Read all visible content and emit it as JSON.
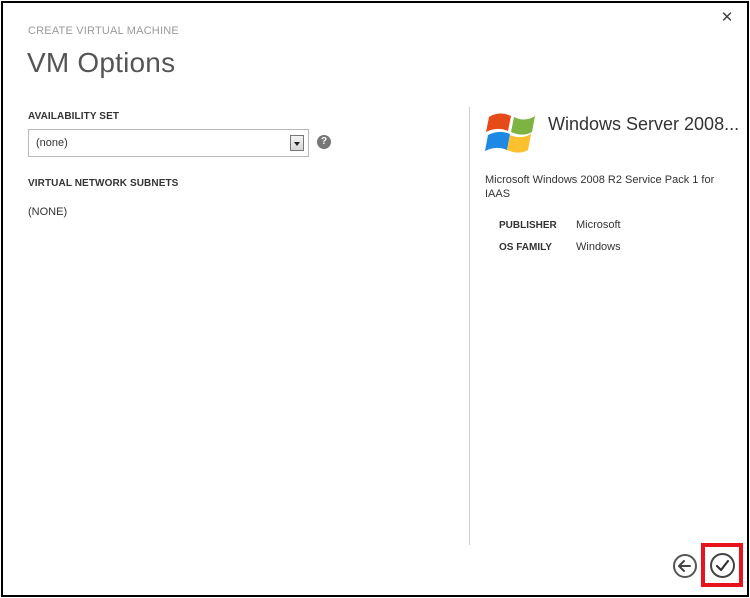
{
  "dialog": {
    "eyebrow": "CREATE VIRTUAL MACHINE",
    "title": "VM Options",
    "close_icon": "close-icon"
  },
  "form": {
    "availability_set": {
      "label": "AVAILABILITY SET",
      "value": "(none)",
      "help_glyph": "?"
    },
    "virtual_network_subnets": {
      "label": "VIRTUAL NETWORK SUBNETS",
      "value": "(NONE)"
    }
  },
  "image_info": {
    "logo_icon": "windows-logo-icon",
    "title": "Windows Server 2008...",
    "description": "Microsoft Windows 2008 R2 Service Pack 1 for IAAS",
    "details": [
      {
        "label": "PUBLISHER",
        "value": "Microsoft"
      },
      {
        "label": "OS FAMILY",
        "value": "Windows"
      }
    ]
  },
  "footer": {
    "back_icon": "back-arrow-icon",
    "complete_icon": "checkmark-icon",
    "highlight_color": "#e8141b"
  }
}
